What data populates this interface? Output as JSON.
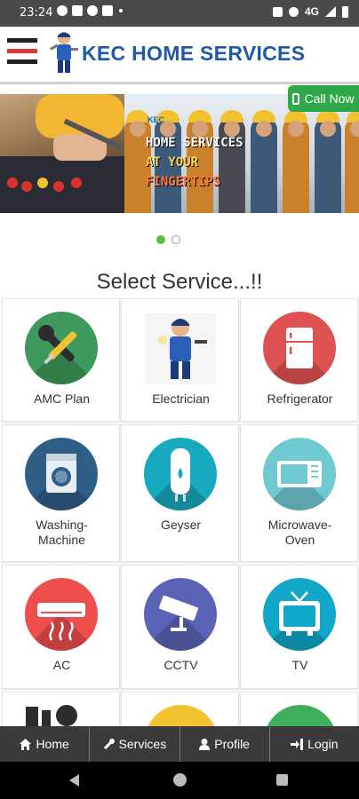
{
  "status_bar": {
    "time": "23:24",
    "network": "4G"
  },
  "header": {
    "brand": "KEC HOME SERVICES"
  },
  "banner": {
    "logo_text": "KEC",
    "line1": "HOME SERVICES",
    "line2": "AT YOUR",
    "line3": "FINGERTIPS",
    "call_label": "Call Now"
  },
  "carousel": {
    "slides": 2,
    "active": 1
  },
  "section_title": "Select Service...!!",
  "services": [
    {
      "label": "AMC Plan",
      "icon": "wrench-screwdriver-icon",
      "color": "#3e9a5c"
    },
    {
      "label": "Electrician",
      "icon": "electrician-icon",
      "color": "#ffffff"
    },
    {
      "label": "Refrigerator",
      "icon": "refrigerator-icon",
      "color": "#e05252"
    },
    {
      "label": "Washing-Machine",
      "icon": "washing-machine-icon",
      "color": "#2f5f86"
    },
    {
      "label": "Geyser",
      "icon": "geyser-icon",
      "color": "#16a9bf"
    },
    {
      "label": "Microwave-Oven",
      "icon": "microwave-icon",
      "color": "#6fc9d1"
    },
    {
      "label": "AC",
      "icon": "air-conditioner-icon",
      "color": "#ee4e4e"
    },
    {
      "label": "CCTV",
      "icon": "cctv-icon",
      "color": "#5b63b7"
    },
    {
      "label": "TV",
      "icon": "tv-icon",
      "color": "#11a7c9"
    }
  ],
  "bottom_nav": {
    "home": "Home",
    "services": "Services",
    "profile": "Profile",
    "login": "Login"
  },
  "colors": {
    "brand_blue": "#1e5aa8",
    "call_green": "#2fa84a",
    "nav_bg": "#3a3a3a",
    "dot_active": "#5bbf3c"
  }
}
